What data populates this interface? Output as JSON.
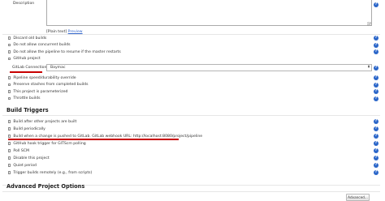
{
  "description": {
    "label": "Description",
    "plain_text_label": "[Plain text]",
    "preview_label": "Preview"
  },
  "general_options": [
    {
      "label": "Discard old builds",
      "checked": false
    },
    {
      "label": "Do not allow concurrent builds",
      "checked": false
    },
    {
      "label": "Do not allow the pipeline to resume if the master restarts",
      "checked": false
    },
    {
      "label": "GitHub project",
      "checked": false
    }
  ],
  "gitlab": {
    "label": "GitLab Connection",
    "selected": "Baymac"
  },
  "pipeline_options": [
    {
      "label": "Pipeline speed/durability override",
      "checked": false
    },
    {
      "label": "Preserve stashes from completed builds",
      "checked": false
    },
    {
      "label": "This project is parameterized",
      "checked": false
    },
    {
      "label": "Throttle builds",
      "checked": false
    }
  ],
  "build_triggers": {
    "title": "Build Triggers",
    "items": [
      {
        "label": "Build after other projects are built",
        "checked": false
      },
      {
        "label": "Build periodically",
        "checked": false
      },
      {
        "label": "Build when a change is pushed to GitLab. GitLab webhook URL: http://localhost:8080/project/pipeline",
        "checked": false
      },
      {
        "label": "GitHub hook trigger for GITScm polling",
        "checked": false
      },
      {
        "label": "Poll SCM",
        "checked": false
      },
      {
        "label": "Disable this project",
        "checked": false
      },
      {
        "label": "Quiet period",
        "checked": false
      },
      {
        "label": "Trigger builds remotely (e.g., from scripts)",
        "checked": false
      }
    ]
  },
  "advanced_project_options": {
    "title": "Advanced Project Options",
    "button_label": "Advanced..."
  },
  "help_icon_glyph": "?",
  "colors": {
    "help_icon": "#2b66c9",
    "link": "#3366cc",
    "annotation_underline": "#c80000"
  }
}
